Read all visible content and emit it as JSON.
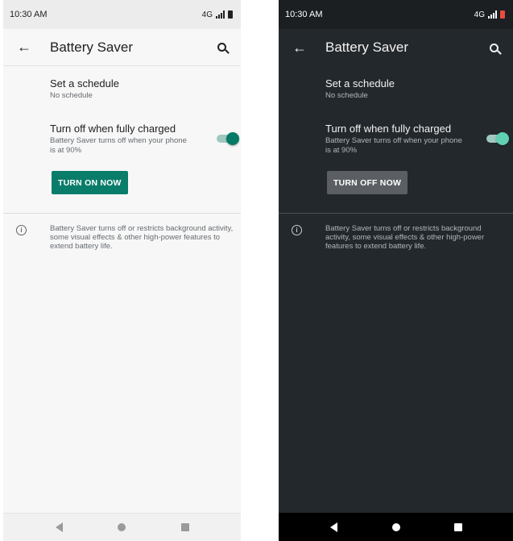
{
  "light": {
    "status_time": "10:30 AM",
    "net_label": "4G",
    "title": "Battery Saver",
    "schedule_title": "Set a schedule",
    "schedule_value": "No schedule",
    "charged_title": "Turn off when fully charged",
    "charged_desc": "Battery Saver turns off when your phone is at 90%",
    "charged_toggle_on": true,
    "action_button": "TURN ON NOW",
    "info_text": "Battery Saver turns off or restricts background activity, some visual effects & other high-power features to extend battery life."
  },
  "dark": {
    "status_time": "10:30 AM",
    "net_label": "4G",
    "title": "Battery Saver",
    "schedule_title": "Set a schedule",
    "schedule_value": "No schedule",
    "charged_title": "Turn off when fully charged",
    "charged_desc": "Battery Saver turns off when your phone is at 90%",
    "charged_toggle_on": true,
    "action_button": "TURN OFF NOW",
    "info_text": "Battery Saver turns off or restricts background activity, some visual effects & other high-power features to extend battery life."
  },
  "icons": {
    "back": "arrow-left",
    "search": "magnifier",
    "info": "info-circle",
    "nav": [
      "back-triangle",
      "home-circle",
      "recents-square"
    ]
  },
  "colors": {
    "accent_light": "#0a7d6a",
    "toggle_dark": "#5fd0b4",
    "dark_background": "#23282c",
    "dark_button": "#5b5f63"
  }
}
